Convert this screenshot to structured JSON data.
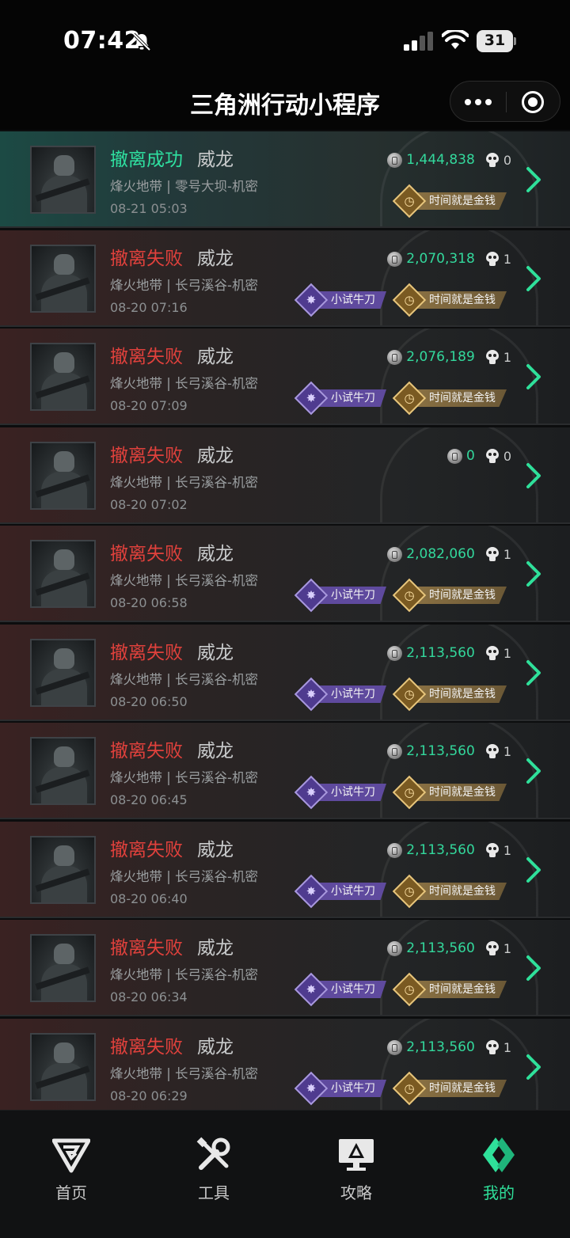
{
  "status_bar": {
    "time": "07:42",
    "battery": "31"
  },
  "header": {
    "title": "三角洲行动小程序"
  },
  "colors": {
    "success": "#2fe0a0",
    "fail": "#e0413c",
    "value": "#33d89c",
    "accent": "#2fe09a"
  },
  "badges": {
    "rookie": "小试牛刀",
    "time_money": "时间就是金钱"
  },
  "records": [
    {
      "status": "撤离成功",
      "result": "success",
      "operator": "威龙",
      "map": "烽火地带 | 零号大坝-机密",
      "time": "08-21 05:03",
      "value": "1,444,838",
      "kills": "0",
      "rookie": false
    },
    {
      "status": "撤离失败",
      "result": "fail",
      "operator": "威龙",
      "map": "烽火地带 | 长弓溪谷-机密",
      "time": "08-20 07:16",
      "value": "2,070,318",
      "kills": "1",
      "rookie": true
    },
    {
      "status": "撤离失败",
      "result": "fail",
      "operator": "威龙",
      "map": "烽火地带 | 长弓溪谷-机密",
      "time": "08-20 07:09",
      "value": "2,076,189",
      "kills": "1",
      "rookie": true
    },
    {
      "status": "撤离失败",
      "result": "fail",
      "operator": "威龙",
      "map": "烽火地带 | 长弓溪谷-机密",
      "time": "08-20 07:02",
      "value": "0",
      "kills": "0",
      "rookie": false,
      "no_badges": true
    },
    {
      "status": "撤离失败",
      "result": "fail",
      "operator": "威龙",
      "map": "烽火地带 | 长弓溪谷-机密",
      "time": "08-20 06:58",
      "value": "2,082,060",
      "kills": "1",
      "rookie": true
    },
    {
      "status": "撤离失败",
      "result": "fail",
      "operator": "威龙",
      "map": "烽火地带 | 长弓溪谷-机密",
      "time": "08-20 06:50",
      "value": "2,113,560",
      "kills": "1",
      "rookie": true
    },
    {
      "status": "撤离失败",
      "result": "fail",
      "operator": "威龙",
      "map": "烽火地带 | 长弓溪谷-机密",
      "time": "08-20 06:45",
      "value": "2,113,560",
      "kills": "1",
      "rookie": true
    },
    {
      "status": "撤离失败",
      "result": "fail",
      "operator": "威龙",
      "map": "烽火地带 | 长弓溪谷-机密",
      "time": "08-20 06:40",
      "value": "2,113,560",
      "kills": "1",
      "rookie": true
    },
    {
      "status": "撤离失败",
      "result": "fail",
      "operator": "威龙",
      "map": "烽火地带 | 长弓溪谷-机密",
      "time": "08-20 06:34",
      "value": "2,113,560",
      "kills": "1",
      "rookie": true
    },
    {
      "status": "撤离失败",
      "result": "fail",
      "operator": "威龙",
      "map": "烽火地带 | 长弓溪谷-机密",
      "time": "08-20 06:29",
      "value": "2,113,560",
      "kills": "1",
      "rookie": true
    }
  ],
  "nav": [
    {
      "label": "首页",
      "icon": "home-logo-icon",
      "active": false
    },
    {
      "label": "工具",
      "icon": "tools-icon",
      "active": false
    },
    {
      "label": "攻略",
      "icon": "guide-monitor-icon",
      "active": false
    },
    {
      "label": "我的",
      "icon": "profile-logo-icon",
      "active": true
    }
  ]
}
